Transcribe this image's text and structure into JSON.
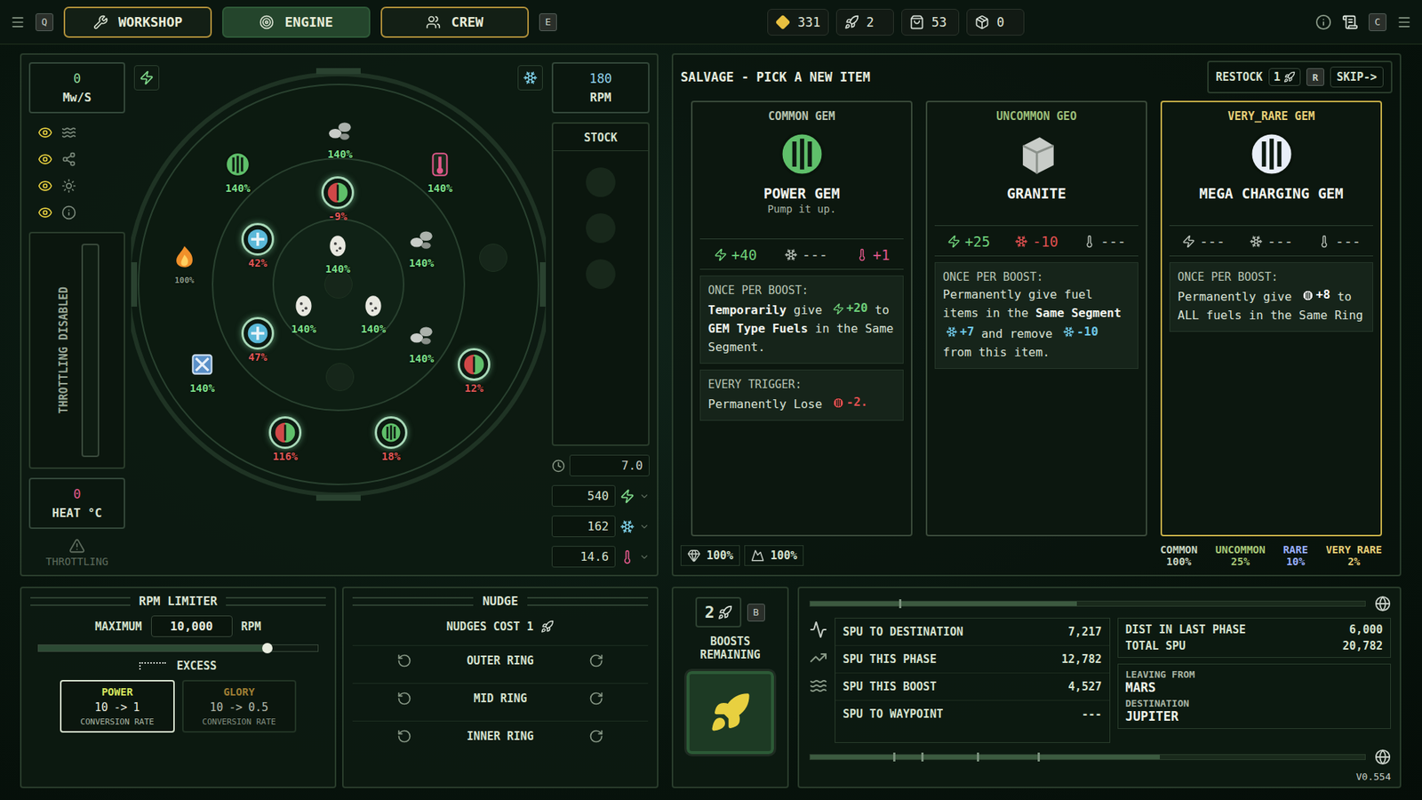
{
  "topbar": {
    "left_key": "Q",
    "tabs": [
      {
        "label": "WORKSHOP",
        "selected": false
      },
      {
        "label": "ENGINE",
        "selected": true
      },
      {
        "label": "CREW",
        "selected": false
      }
    ],
    "right_key": "E",
    "resources": [
      {
        "kind": "gold",
        "value": "331"
      },
      {
        "kind": "boost",
        "value": "2"
      },
      {
        "kind": "bag",
        "value": "53"
      },
      {
        "kind": "crate",
        "value": "0"
      }
    ],
    "corner_key": "C"
  },
  "engine": {
    "power": {
      "value": "0",
      "unit": "Mw/S"
    },
    "rpm": {
      "value": "180",
      "unit": "RPM"
    },
    "heat": {
      "value": "0",
      "unit": "HEAT °C"
    },
    "filters": [
      {
        "kind": "wave",
        "visible": true
      },
      {
        "kind": "links",
        "visible": true
      },
      {
        "kind": "sun",
        "visible": true
      },
      {
        "kind": "info",
        "visible": true
      }
    ],
    "throttle": {
      "label": "THROTTLING DISABLED",
      "level": 0
    },
    "throttling_warning": {
      "label": "THROTTLING",
      "disabled": true
    },
    "stock": {
      "label": "STOCK",
      "slots": [
        {
          "filled": false
        },
        {
          "filled": false
        },
        {
          "filled": false
        }
      ]
    },
    "readings": [
      {
        "kind": "power",
        "value": "540",
        "color": "#7fd88a"
      },
      {
        "kind": "cool",
        "value": "162",
        "color": "#7fd0e8"
      },
      {
        "kind": "heat",
        "value": "14.6",
        "color": "#e0588a"
      }
    ],
    "timer": "7.0",
    "nodes": [
      {
        "kind": "rocks",
        "color": "#c8ccc8",
        "label": "140%",
        "tone": "positive",
        "ringed": false
      },
      {
        "kind": "gem",
        "color": "#5fbf6a",
        "label": "140%",
        "tone": "positive",
        "ringed": false
      },
      {
        "kind": "thermo",
        "color": "#e0588a",
        "label": "140%",
        "tone": "positive",
        "ringed": false
      },
      {
        "kind": "split-gem",
        "color": "#d04848",
        "label": "-9%",
        "tone": "negative",
        "ringed": true
      },
      {
        "kind": "cross-gem",
        "color": "#5ab8d8",
        "label": "42%",
        "tone": "negative",
        "ringed": true
      },
      {
        "kind": "egg",
        "color": "#e8e8e0",
        "label": "140%",
        "tone": "positive",
        "ringed": false
      },
      {
        "kind": "rocks",
        "color": "#c8ccc8",
        "label": "140%",
        "tone": "positive",
        "ringed": false
      },
      {
        "kind": "fire",
        "color": "#f0902a",
        "label": "100%",
        "tone": "muted",
        "ringed": false
      },
      {
        "kind": "egg",
        "color": "#e8e8e0",
        "label": "140%",
        "tone": "positive",
        "ringed": false
      },
      {
        "kind": "egg",
        "color": "#e8e8e0",
        "label": "140%",
        "tone": "positive",
        "ringed": false
      },
      {
        "kind": "cross-gem",
        "color": "#5ab8d8",
        "label": "47%",
        "tone": "negative",
        "ringed": true
      },
      {
        "kind": "rocks",
        "color": "#c8ccc8",
        "label": "140%",
        "tone": "positive",
        "ringed": false
      },
      {
        "kind": "box",
        "color": "#5a90c8",
        "label": "140%",
        "tone": "positive",
        "ringed": false
      },
      {
        "kind": "split-gem",
        "color": "#d04848",
        "label": "12%",
        "tone": "negative",
        "ringed": true
      },
      {
        "kind": "split-gem",
        "color": "#d04848",
        "label": "116%",
        "tone": "negative",
        "ringed": true
      },
      {
        "kind": "gem",
        "color": "#5fbf6a",
        "label": "18%",
        "tone": "negative",
        "ringed": true
      }
    ],
    "empty_slots": [
      {
        "filled": false
      },
      {
        "filled": false
      },
      {
        "filled": false
      }
    ]
  },
  "rpm_limiter": {
    "title": "RPM LIMITER",
    "max_label": "MAXIMUM",
    "max_value": "10,000",
    "unit": "RPM",
    "level": 0.82,
    "excess_label": "EXCESS",
    "modes": [
      {
        "name": "POWER",
        "from": "10",
        "arrow": "->",
        "to": "1",
        "caption": "CONVERSION RATE",
        "selected": true
      },
      {
        "name": "GLORY",
        "from": "10",
        "arrow": "->",
        "to": "0.5",
        "caption": "CONVERSION RATE",
        "selected": false
      }
    ]
  },
  "nudge": {
    "title": "NUDGE",
    "cost_label": "NUDGES COST 1",
    "rings": [
      {
        "label": "OUTER RING"
      },
      {
        "label": "MID RING"
      },
      {
        "label": "INNER RING"
      }
    ]
  },
  "salvage": {
    "title": "SALVAGE - PICK A NEW ITEM",
    "restock": {
      "label": "RESTOCK",
      "cost": "1",
      "key": "R"
    },
    "skip": "SKIP->",
    "cards": [
      {
        "rarity": "COMMON GEM",
        "rarity_color": "#b8c4b0",
        "name": "POWER GEM",
        "subtitle": "Pump it up.",
        "icon": "gem",
        "color": "#5fbf6a",
        "selected": false,
        "stats": [
          {
            "kind": "power",
            "value": "+40",
            "color": "#6fd07a"
          },
          {
            "kind": "cool",
            "value": "---",
            "color": "#b8c0b8"
          },
          {
            "kind": "heat",
            "value": "+1",
            "color": "#e0588a"
          }
        ],
        "effects": [
          {
            "title": "ONCE PER BOOST:",
            "body": [
              {
                "kind": "em",
                "text": "Temporarily"
              },
              {
                "kind": "text",
                "text": " give "
              },
              {
                "kind": "power",
                "text": "+20",
                "color": "#6fd07a"
              },
              {
                "kind": "text",
                "text": " to "
              },
              {
                "kind": "em",
                "text": "GEM Type Fuels"
              },
              {
                "kind": "text",
                "text": " in the Same Segment."
              }
            ]
          },
          {
            "title": "EVERY TRIGGER:",
            "body": [
              {
                "kind": "text",
                "text": "Permanently Lose "
              },
              {
                "kind": "charge",
                "text": "-2.",
                "color": "#e05050"
              }
            ]
          }
        ]
      },
      {
        "rarity": "UNCOMMON GEO",
        "rarity_color": "#9cbf7a",
        "name": "GRANITE",
        "icon": "granite",
        "color": "#c8ccc8",
        "selected": false,
        "stats": [
          {
            "kind": "power",
            "value": "+25",
            "color": "#6fd07a"
          },
          {
            "kind": "cool",
            "value": "-10",
            "color": "#e05050"
          },
          {
            "kind": "heat",
            "value": "---",
            "color": "#b8c0b8"
          }
        ],
        "effects": [
          {
            "title": "ONCE PER BOOST:",
            "body": [
              {
                "kind": "text",
                "text": "Permanently give fuel items in the "
              },
              {
                "kind": "em",
                "text": "Same Segment"
              },
              {
                "kind": "cool",
                "text": "+7",
                "color": "#6fc8e8"
              },
              {
                "kind": "text",
                "text": " and remove "
              },
              {
                "kind": "cool",
                "text": "-10",
                "color": "#6fc8e8"
              },
              {
                "kind": "text",
                "text": " from this item."
              }
            ]
          }
        ]
      },
      {
        "rarity": "VERY_RARE GEM",
        "rarity_color": "#e8d078",
        "name": "MEGA CHARGING GEM",
        "icon": "mega",
        "color": "#e8eef8",
        "selected": true,
        "stats": [
          {
            "kind": "power",
            "value": "---",
            "color": "#b8c0b8"
          },
          {
            "kind": "cool",
            "value": "---",
            "color": "#b8c0b8"
          },
          {
            "kind": "heat",
            "value": "---",
            "color": "#b8c0b8"
          }
        ],
        "effects": [
          {
            "title": "ONCE PER BOOST:",
            "body": [
              {
                "kind": "text",
                "text": "Permanently give "
              },
              {
                "kind": "charge",
                "text": "+8",
                "color": "#ffffff"
              },
              {
                "kind": "text",
                "text": " to ALL fuels in the Same Ring"
              }
            ]
          }
        ]
      }
    ],
    "bonuses": [
      {
        "kind": "gem",
        "value": "100%"
      },
      {
        "kind": "geo",
        "value": "100%"
      }
    ],
    "rarities": [
      {
        "name": "COMMON",
        "chance": "100%",
        "color": "#c8d4c0"
      },
      {
        "name": "UNCOMMON",
        "chance": "25%",
        "color": "#a8c878"
      },
      {
        "name": "RARE",
        "chance": "10%",
        "color": "#9ab0ff"
      },
      {
        "name": "VERY RARE",
        "chance": "2%",
        "color": "#e8d078"
      }
    ]
  },
  "boosts": {
    "count": "2",
    "label": "BOOSTS REMAINING",
    "key": "B"
  },
  "journey": {
    "top_track": {
      "level": 0.48,
      "markers": [
        0.16
      ]
    },
    "bottom_track": {
      "level": 0.63,
      "markers": [
        0.15,
        0.2,
        0.3,
        0.41
      ]
    },
    "stats": [
      {
        "label": "SPU TO DESTINATION",
        "value": "7,217"
      },
      {
        "label": "SPU THIS PHASE",
        "value": "12,782"
      },
      {
        "label": "SPU THIS BOOST",
        "value": "4,527"
      },
      {
        "label": "SPU TO WAYPOINT",
        "value": "---"
      }
    ],
    "totals": [
      {
        "label": "DIST IN LAST PHASE",
        "value": "6,000"
      },
      {
        "label": "TOTAL SPU",
        "value": "20,782"
      }
    ],
    "route": [
      {
        "label": "LEAVING FROM",
        "value": "MARS"
      },
      {
        "label": "DESTINATION",
        "value": "JUPITER"
      }
    ]
  },
  "version": "V0.554"
}
